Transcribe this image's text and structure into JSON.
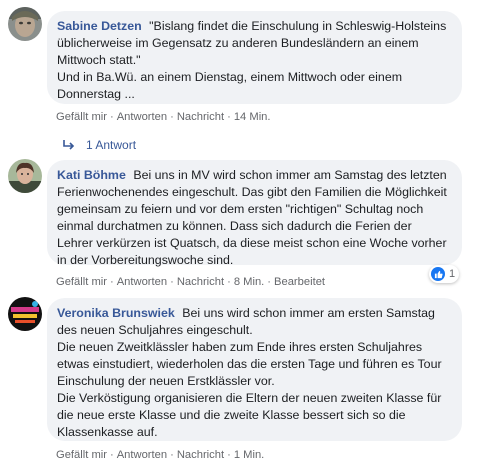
{
  "colors": {
    "author": "#385898",
    "bubble_bg": "#f0f2f5",
    "meta": "#65676b",
    "like": "#1877f2"
  },
  "comments": [
    {
      "author": "Sabine Detzen",
      "text": "\"Bislang findet die Einschulung in Schleswig-Holsteins üblicherweise im Gegensatz zu anderen Bundesländern an einem Mittwoch statt.\"\nUnd in Ba.Wü. an einem Dienstag, einem Mittwoch oder einem Donnerstag ...",
      "like": "Gefällt mir",
      "reply": "Antworten",
      "message": "Nachricht",
      "time": "14 Min."
    },
    {
      "author": "Kati Böhme",
      "text": "Bei uns in MV wird schon immer am Samstag des letzten Ferienwochenendes eingeschult. Das gibt den Familien die Möglichkeit gemeinsam zu feiern und vor dem ersten \"richtigen\" Schultag noch einmal durchatmen zu können. Dass sich dadurch die Ferien der Lehrer verkürzen ist Quatsch, da diese meist schon eine Woche vorher in der Vorbereitungswoche sind.",
      "like": "Gefällt mir",
      "reply": "Antworten",
      "message": "Nachricht",
      "time": "8 Min.",
      "edited": "Bearbeitet",
      "reaction_count": "1"
    },
    {
      "author": "Veronika Brunswiek",
      "text": "Bei uns wird schon immer am ersten Samstag des neuen Schuljahres eingeschult.\nDie neuen Zweitklässler haben zum Ende ihres ersten Schuljahres etwas einstudiert, wiederholen das die ersten Tage und führen es Tour Einschulung der neuen Erstklässler vor.\nDie Verköstigung organisieren die Eltern der neuen zweiten Klasse für die neue erste Klasse und die zweite Klasse bessert sich so die Klassenkasse auf.",
      "like": "Gefällt mir",
      "reply": "Antworten",
      "message": "Nachricht",
      "time": "1 Min."
    }
  ],
  "replies_link": "1 Antwort"
}
